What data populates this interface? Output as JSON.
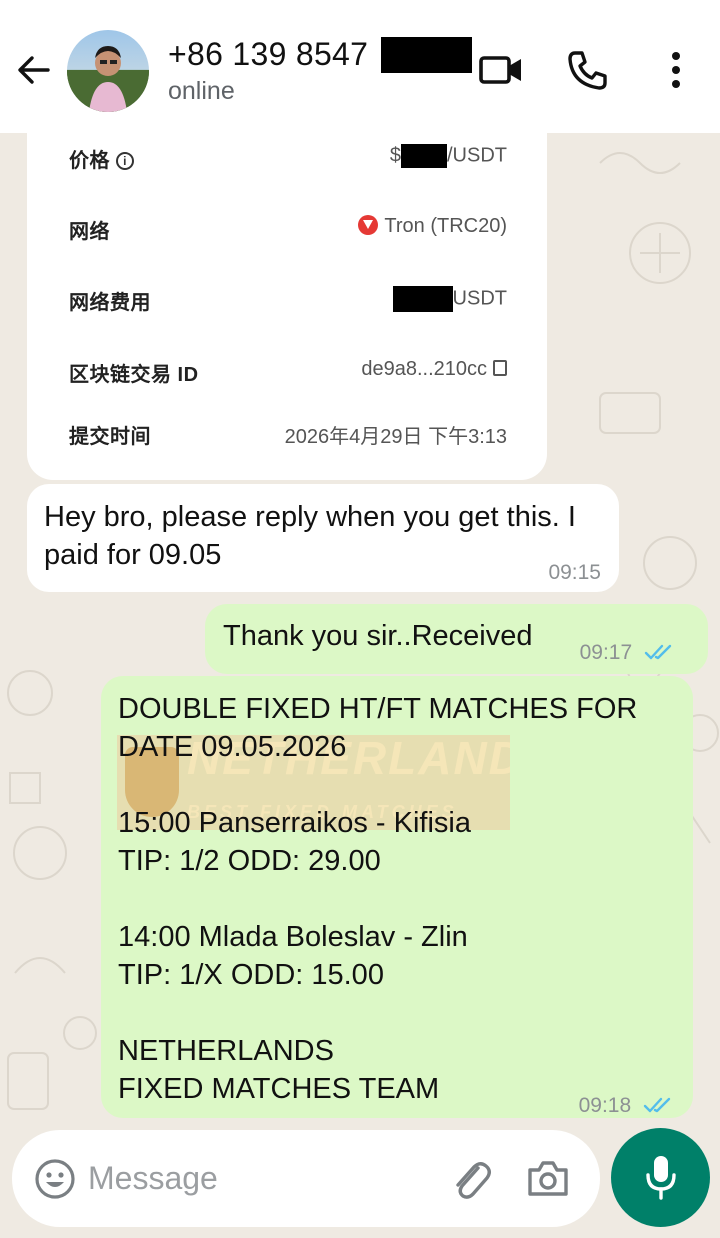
{
  "header": {
    "contact_name": "+86 139 8547",
    "status": "online",
    "icons": [
      "back-arrow-icon",
      "video-call-icon",
      "voice-call-icon",
      "more-options-icon"
    ]
  },
  "payment_card": {
    "rows": [
      {
        "label": "价格",
        "value_prefix": "$",
        "value_suffix": "/USDT"
      },
      {
        "label": "网络",
        "value": "Tron (TRC20)"
      },
      {
        "label": "网络费用",
        "value_suffix": "USDT"
      },
      {
        "label": "区块链交易 ID",
        "value": "de9a8...210cc"
      },
      {
        "label": "提交时间",
        "value": "2026年4月29日 下午3:13"
      }
    ]
  },
  "messages": [
    {
      "direction": "incoming",
      "text": "Hey bro, please reply when you get this. I paid for 09.05",
      "time": "09:15"
    },
    {
      "direction": "outgoing",
      "text": "Thank you sir..Received",
      "time": "09:17",
      "status": "read"
    },
    {
      "direction": "outgoing",
      "lines": [
        "DOUBLE FIXED HT/FT MATCHES FOR",
        "DATE 09.05.2026",
        "",
        "15:00  Panserraikos - Kifisia",
        "TIP: 1/2  ODD: 29.00",
        "",
        "14:00  Mlada Boleslav - Zlin",
        "TIP: 1/X  ODD: 15.00",
        "",
        "NETHERLANDS",
        "FIXED MATCHES TEAM"
      ],
      "watermark": {
        "title": "NETHERLANDS",
        "subtitle": "BEST FIXED MATCHES"
      },
      "time": "09:18",
      "status": "read"
    }
  ],
  "composer": {
    "placeholder": "Message",
    "icons": [
      "emoji-icon",
      "attach-icon",
      "camera-icon",
      "mic-icon"
    ]
  },
  "colors": {
    "header_bg": "#ffffff",
    "chat_bg": "#efeae2",
    "outgoing_bubble": "#dcf8c6",
    "incoming_bubble": "#ffffff",
    "read_ticks": "#53bdeb",
    "accent": "#008069"
  }
}
